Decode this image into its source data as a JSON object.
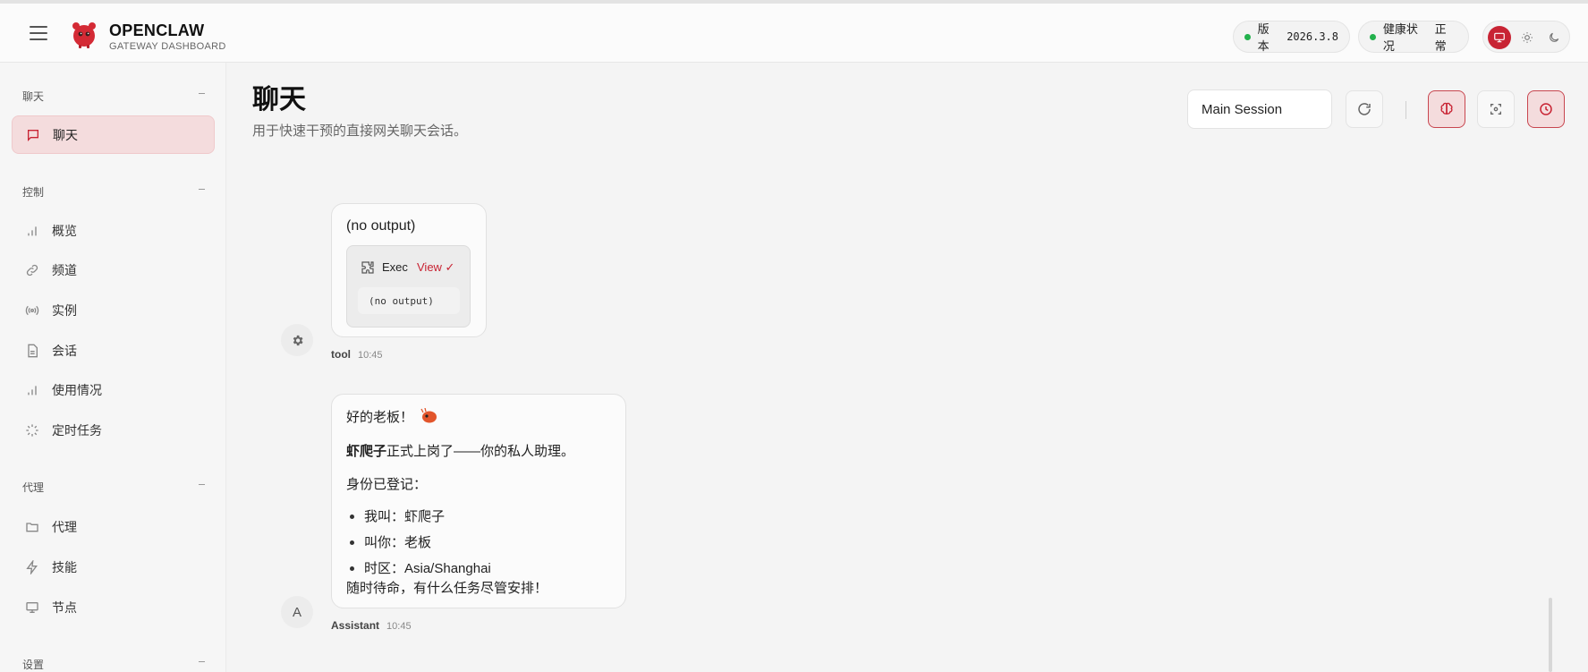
{
  "brand": {
    "title": "OPENCLAW",
    "subtitle": "GATEWAY DASHBOARD"
  },
  "status": {
    "version_label": "版本",
    "version_value": "2026.3.8",
    "health_label": "健康状况",
    "health_value": "正常",
    "status_color": "#22b14c"
  },
  "theme": {
    "options": [
      "system",
      "light",
      "dark"
    ],
    "active": "system",
    "accent": "#c82333"
  },
  "sidebar": {
    "sections": [
      {
        "title": "聊天",
        "items": [
          {
            "label": "聊天",
            "icon": "message-icon",
            "active": true
          }
        ]
      },
      {
        "title": "控制",
        "items": [
          {
            "label": "概览",
            "icon": "bar-chart-icon"
          },
          {
            "label": "频道",
            "icon": "link-icon"
          },
          {
            "label": "实例",
            "icon": "radio-icon"
          },
          {
            "label": "会话",
            "icon": "file-icon"
          },
          {
            "label": "使用情况",
            "icon": "bar-chart-icon"
          },
          {
            "label": "定时任务",
            "icon": "loader-icon"
          }
        ]
      },
      {
        "title": "代理",
        "items": [
          {
            "label": "代理",
            "icon": "folder-icon"
          },
          {
            "label": "技能",
            "icon": "zap-icon"
          },
          {
            "label": "节点",
            "icon": "monitor-icon"
          }
        ]
      },
      {
        "title": "设置",
        "items": []
      }
    ]
  },
  "header": {
    "title": "聊天",
    "subtitle": "用于快速干预的直接网关聊天会话。",
    "session": "Main Session"
  },
  "messages": [
    {
      "role": "tool",
      "avatar": "gear-icon",
      "text": "(no output)",
      "tool": {
        "name": "Exec",
        "action": "View ✓",
        "output": "(no output)"
      },
      "sender": "tool",
      "time": "10:45"
    },
    {
      "role": "assistant",
      "avatar": "A",
      "lines": {
        "greeting": "好的老板！",
        "intro_bold": "虾爬子",
        "intro_rest": "正式上岗了——你的私人助理。",
        "identity": "身份已登记：",
        "bullets": [
          "我叫：虾爬子",
          "叫你：老板",
          "时区：Asia/Shanghai"
        ],
        "closing": "随时待命，有什么任务尽管安排！"
      },
      "sender": "Assistant",
      "time": "10:45"
    }
  ]
}
